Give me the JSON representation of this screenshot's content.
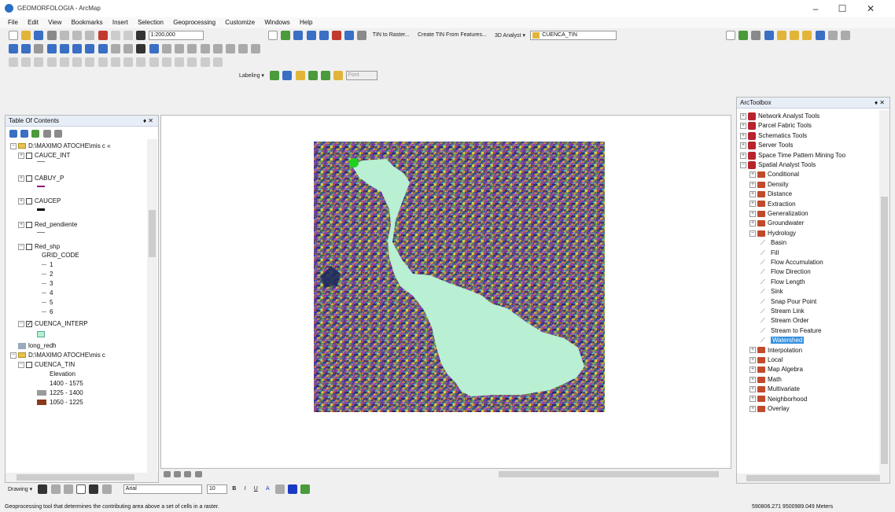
{
  "window": {
    "title": "GEOMORFOLOGIA - ArcMap",
    "minimize": "–",
    "maximize": "☐",
    "close": "✕"
  },
  "menu": [
    "File",
    "Edit",
    "View",
    "Bookmarks",
    "Insert",
    "Selection",
    "Geoprocessing",
    "Customize",
    "Windows",
    "Help"
  ],
  "toolbar": {
    "scale": "1:200,000",
    "tin_to_raster": "TIN to Raster...",
    "create_tin": "Create TIN From Features...",
    "analyst_3d": "3D Analyst ▾",
    "layer": "CUENCA_TIN",
    "labeling": "Labeling ▾",
    "font_box": "Font",
    "colors": {
      "blue": "#3a6fc4",
      "green": "#4b9a3c",
      "red": "#c23a2e",
      "yellow": "#e2b53a",
      "gray": "#8a8a8a"
    }
  },
  "toc": {
    "title": "Table Of Contents",
    "pin": "♦ ✕",
    "items": [
      {
        "kind": "folder",
        "label": "D:\\MAXIMO ATOCHE\\mis c «"
      },
      {
        "kind": "layer",
        "label": "CAUCE_INT",
        "checked": false
      },
      {
        "kind": "layer",
        "label": "CABUY_P",
        "checked": false
      },
      {
        "kind": "layer",
        "label": "CAUCEP",
        "checked": false
      },
      {
        "kind": "layer",
        "label": "Red_pendiente",
        "checked": false
      },
      {
        "kind": "layer",
        "label": "Red_shp",
        "checked": false
      },
      {
        "kind": "legend",
        "label": "GRID_CODE"
      },
      {
        "kind": "legend",
        "label": "1"
      },
      {
        "kind": "legend",
        "label": "2"
      },
      {
        "kind": "legend",
        "label": "3"
      },
      {
        "kind": "legend",
        "label": "4"
      },
      {
        "kind": "legend",
        "label": "5"
      },
      {
        "kind": "legend",
        "label": "6"
      },
      {
        "kind": "layer",
        "label": "CUENCA_INTERP",
        "checked": true
      },
      {
        "kind": "layer",
        "label": "long_redh",
        "checked": false
      },
      {
        "kind": "folder",
        "label": "D:\\MAXIMO ATOCHE\\mis c"
      },
      {
        "kind": "layer",
        "label": "CUENCA_TIN",
        "checked": false
      },
      {
        "kind": "legend",
        "label": "Elevation"
      },
      {
        "kind": "legend",
        "label": "1400 - 1575"
      },
      {
        "kind": "legend",
        "label": "1225 - 1400"
      },
      {
        "kind": "legend",
        "label": "1050 - 1225"
      }
    ]
  },
  "toolbox": {
    "title": "ArcToolbox",
    "pin": "♦ ✕",
    "items": [
      {
        "kind": "box",
        "label": "Network Analyst Tools"
      },
      {
        "kind": "box",
        "label": "Parcel Fabric Tools"
      },
      {
        "kind": "box",
        "label": "Schematics Tools"
      },
      {
        "kind": "box",
        "label": "Server Tools"
      },
      {
        "kind": "box",
        "label": "Space Time Pattern Mining Too"
      },
      {
        "kind": "box",
        "label": "Spatial Analyst Tools"
      },
      {
        "kind": "set",
        "label": "Conditional"
      },
      {
        "kind": "set",
        "label": "Density"
      },
      {
        "kind": "set",
        "label": "Distance"
      },
      {
        "kind": "set",
        "label": "Extraction"
      },
      {
        "kind": "set",
        "label": "Generalization"
      },
      {
        "kind": "set",
        "label": "Groundwater"
      },
      {
        "kind": "set",
        "label": "Hydrology"
      },
      {
        "kind": "tool",
        "label": "Basin"
      },
      {
        "kind": "tool",
        "label": "Fill"
      },
      {
        "kind": "tool",
        "label": "Flow Accumulation"
      },
      {
        "kind": "tool",
        "label": "Flow Direction"
      },
      {
        "kind": "tool",
        "label": "Flow Length"
      },
      {
        "kind": "tool",
        "label": "Sink"
      },
      {
        "kind": "tool",
        "label": "Snap Pour Point"
      },
      {
        "kind": "tool",
        "label": "Stream Link"
      },
      {
        "kind": "tool",
        "label": "Stream Order"
      },
      {
        "kind": "tool",
        "label": "Stream to Feature"
      },
      {
        "kind": "tool",
        "label": "Watershed",
        "selected": true
      },
      {
        "kind": "set",
        "label": "Interpolation"
      },
      {
        "kind": "set",
        "label": "Local"
      },
      {
        "kind": "set",
        "label": "Map Algebra"
      },
      {
        "kind": "set",
        "label": "Math"
      },
      {
        "kind": "set",
        "label": "Multivariate"
      },
      {
        "kind": "set",
        "label": "Neighborhood"
      },
      {
        "kind": "set",
        "label": "Overlay"
      }
    ]
  },
  "drawing_toolbar": {
    "drawing": "Drawing ▾",
    "font": "Arial",
    "size": "10",
    "bold": "B",
    "italic": "I",
    "underline": "U",
    "font_color": "A"
  },
  "status": {
    "message": "Geoprocessing tool that determines the contributing area above a set of cells in a raster.",
    "coords": "590806.271  9500989.049 Meters"
  },
  "map": {
    "watershed_color": "#b9efd3",
    "pour_point_color": "#1fd11f"
  }
}
